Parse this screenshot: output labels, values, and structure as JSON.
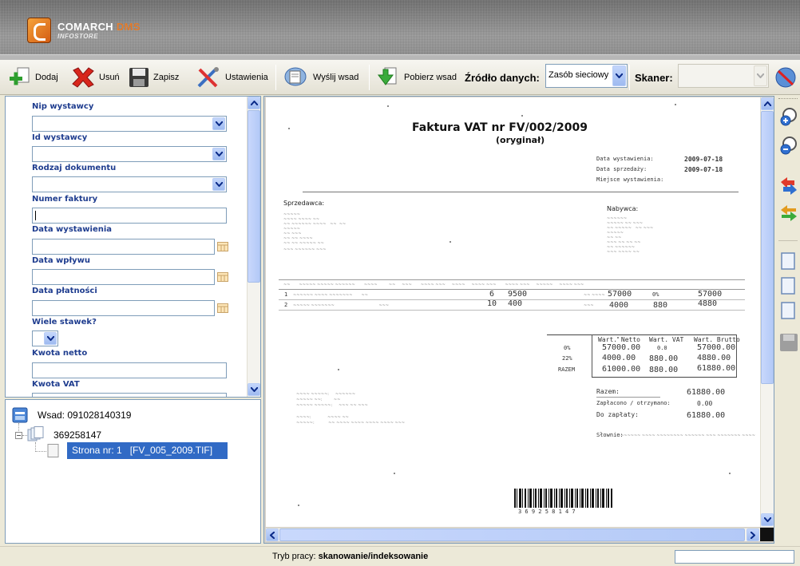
{
  "brand": {
    "name": "COMARCH",
    "name_accent": "DMS",
    "subtitle": "INFOSTORE"
  },
  "toolbar": {
    "add_label": "Dodaj",
    "delete_label": "Usuń",
    "save_label": "Zapisz",
    "settings_label": "Ustawienia",
    "send_batch_label": "Wyślij wsad",
    "fetch_batch_label": "Pobierz wsad",
    "data_source_label": "Źródło danych:",
    "data_source_value": "Zasób sieciowy",
    "scanner_label": "Skaner:",
    "scanner_value": ""
  },
  "form": {
    "fields": [
      {
        "label": "Nip wystawcy",
        "type": "select",
        "value": ""
      },
      {
        "label": "Id wystawcy",
        "type": "select",
        "value": ""
      },
      {
        "label": "Rodzaj dokumentu",
        "type": "select",
        "value": ""
      },
      {
        "label": "Numer faktury",
        "type": "text",
        "value": ""
      },
      {
        "label": "Data wystawienia",
        "type": "date",
        "value": ""
      },
      {
        "label": "Data wpływu",
        "type": "date",
        "value": ""
      },
      {
        "label": "Data płatności",
        "type": "date",
        "value": ""
      },
      {
        "label": "Wiele stawek?",
        "type": "small-select",
        "value": ""
      },
      {
        "label": "Kwota netto",
        "type": "text",
        "value": ""
      },
      {
        "label": "Kwota VAT",
        "type": "text",
        "value": ""
      }
    ]
  },
  "tree": {
    "batch_label": "Wsad: 091028140319",
    "document_label": "369258147",
    "page_label": "Strona nr: 1   [FV_005_2009.TIF]"
  },
  "document": {
    "title": "Faktura VAT nr FV/002/2009",
    "subtitle": "(oryginał)",
    "issue_date_label": "Data wystawienia:",
    "issue_date": "2009-07-18",
    "sale_date_label": "Data sprzedaży:",
    "sale_date": "2009-07-18",
    "place_label": "Miejsce wystawienia:",
    "seller_label": "Sprzedawca:",
    "buyer_label": "Nabywca:",
    "items": [
      {
        "lp": "1",
        "qty": "6",
        "price": "9500",
        "net": "57000",
        "vat": "0%",
        "gross": "57000"
      },
      {
        "lp": "2",
        "qty": "10",
        "price": "400",
        "net": "4000",
        "vat": "880",
        "gross": "4880"
      }
    ],
    "summary_headers": [
      "Wart. Netto",
      "Wart. VAT",
      "Wart. Brutto"
    ],
    "summary_rows": [
      {
        "rate": "0%",
        "net": "57000.00",
        "vat": "0.0",
        "gross": "57000.00"
      },
      {
        "rate": "22%",
        "net": "4000.00",
        "vat": "880.00",
        "gross": "4880.00"
      },
      {
        "rate": "RAZEM",
        "net": "61000.00",
        "vat": "880.00",
        "gross": "61880.00"
      }
    ],
    "total_label": "Razem:",
    "total_value": "61880.00",
    "paid_label": "Zapłacono / otrzymano:",
    "paid_value": "0.00",
    "to_pay_label": "Do zapłaty:",
    "to_pay_value": "61880.00",
    "in_words_label": "Słownie:",
    "barcode_digits": "3 6 9 2 5 8 1 4 7"
  },
  "status": {
    "mode_label": "Tryb pracy:",
    "mode_value": "skanowanie/indeksowanie"
  },
  "colors": {
    "label_blue": "#1f3d8f",
    "selection": "#316ac5",
    "accent_orange": "#e07a2c"
  }
}
